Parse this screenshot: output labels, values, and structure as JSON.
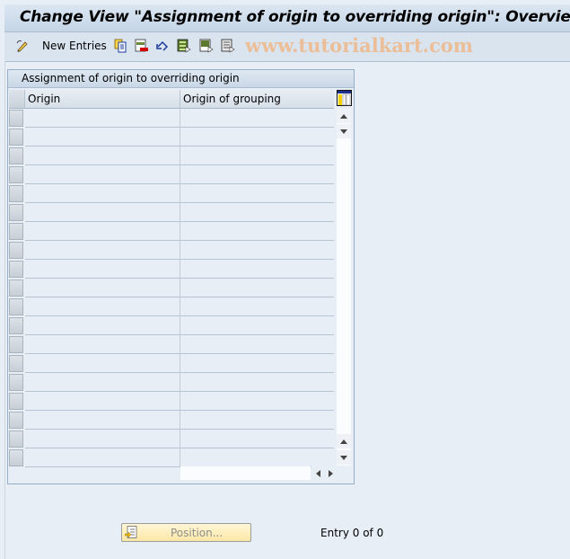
{
  "window": {
    "title": "Change View \"Assignment of origin to overriding origin\": Overview"
  },
  "toolbar": {
    "items": [
      {
        "name": "display-change-icon",
        "label": ""
      },
      {
        "name": "new-entries-button",
        "label": "New Entries"
      },
      {
        "name": "copy-as-icon",
        "label": ""
      },
      {
        "name": "delete-icon",
        "label": ""
      },
      {
        "name": "undo-change-icon",
        "label": ""
      },
      {
        "name": "select-all-icon",
        "label": ""
      },
      {
        "name": "select-block-icon",
        "label": ""
      },
      {
        "name": "deselect-all-icon",
        "label": ""
      }
    ],
    "new_entries_label": "New Entries",
    "watermark": "www.tutorialkart.com"
  },
  "table": {
    "title": "Assignment of origin to overriding origin",
    "columns": [
      "Origin",
      "Origin of grouping"
    ],
    "row_count": 19,
    "rows": []
  },
  "footer": {
    "position_label": "Position...",
    "entry_text": "Entry 0 of 0"
  },
  "colors": {
    "background": "#e8eef6",
    "title_bar": "#c5d5e6",
    "watermark": "#f0b88a",
    "position_button": "#fbe8a6"
  }
}
